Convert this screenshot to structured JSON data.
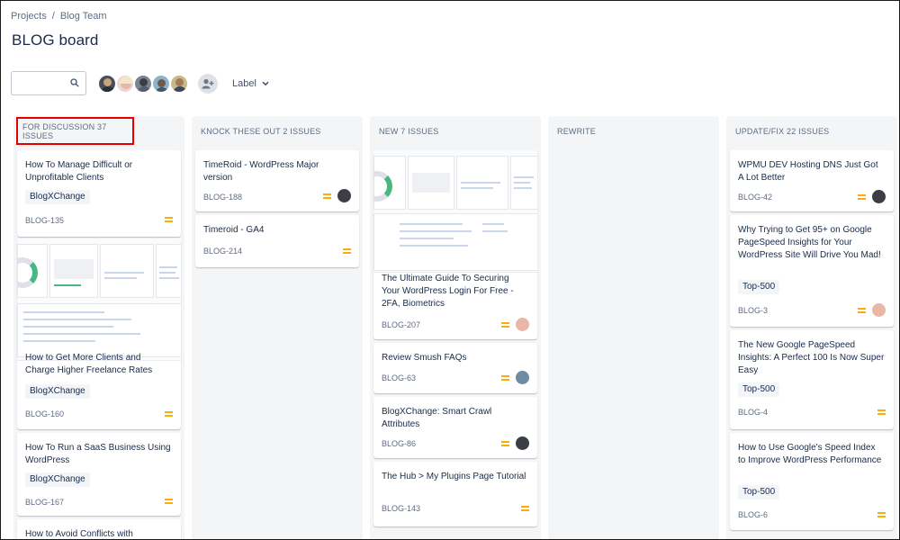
{
  "breadcrumb": {
    "projects": "Projects",
    "separator": "/",
    "team": "Blog Team"
  },
  "page_title": "BLOG board",
  "toolbar": {
    "search_placeholder": "",
    "label_filter": "Label"
  },
  "colors": {
    "priority_medium": "#ffab00",
    "highlight_border": "#e60000",
    "column_bg": "#f4f5f7"
  },
  "columns": [
    {
      "header": "FOR DISCUSSION 37 ISSUES",
      "cards": [
        {
          "title": "How To Manage Difficult or Unprofitable Clients",
          "label": "BlogXChange",
          "key": "BLOG-135"
        },
        {
          "title": "How to Get More Clients and Charge Higher Freelance Rates",
          "label": "BlogXChange",
          "key": "BLOG-160"
        },
        {
          "title": "How To Run a SaaS Business Using WordPress",
          "label": "BlogXChange",
          "key": "BLOG-167"
        },
        {
          "title": "How to Avoid Conflicts with"
        }
      ]
    },
    {
      "header": "KNOCK THESE OUT 2 ISSUES",
      "cards": [
        {
          "title": "TimeRoid - WordPress Major version",
          "key": "BLOG-188"
        },
        {
          "title": "Timeroid - GA4",
          "key": "BLOG-214"
        }
      ]
    },
    {
      "header": "NEW 7 ISSUES",
      "cards": [
        {
          "title": "The Ultimate Guide To Securing Your WordPress Login For Free - 2FA, Biometrics",
          "key": "BLOG-207"
        },
        {
          "title": "Review Smush FAQs",
          "key": "BLOG-63"
        },
        {
          "title": "BlogXChange: Smart Crawl Attributes",
          "key": "BLOG-86"
        },
        {
          "title": "The Hub > My Plugins Page Tutorial",
          "key": "BLOG-143"
        }
      ]
    },
    {
      "header": "REWRITE",
      "cards": []
    },
    {
      "header": "UPDATE/FIX 22 ISSUES",
      "cards": [
        {
          "title": "WPMU DEV Hosting DNS Just Got A Lot Better",
          "key": "BLOG-42"
        },
        {
          "title": "Why Trying to Get 95+ on Google PageSpeed Insights for Your WordPress Site Will Drive You Mad!",
          "label": "Top-500",
          "key": "BLOG-3"
        },
        {
          "title": "The New Google PageSpeed Insights: A Perfect 100 Is Now Super Easy",
          "label": "Top-500",
          "key": "BLOG-4"
        },
        {
          "title": "How to Use Google's Speed Index to Improve WordPress Performance",
          "label": "Top-500",
          "key": "BLOG-6"
        }
      ]
    }
  ]
}
